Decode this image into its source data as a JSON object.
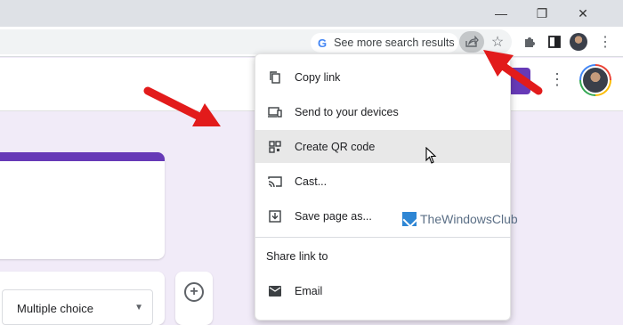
{
  "window": {
    "minimize_glyph": "—",
    "restore_glyph": "❐",
    "close_glyph": "✕"
  },
  "toolbar": {
    "search_chip": {
      "icon": "google-g-icon",
      "g_letter": "G",
      "label": "See more search results"
    },
    "share_icon": "share-icon",
    "star_glyph": "☆",
    "extensions_icon": "puzzle-icon",
    "side_panel_icon": "side-panel-icon",
    "more_glyph": "⋮"
  },
  "forms_header": {
    "more_glyph": "⋮"
  },
  "form": {
    "question_type": "Multiple choice",
    "dropdown_glyph": "▼",
    "add_question_glyph": "+"
  },
  "share_menu": {
    "items": [
      {
        "label": "Copy link",
        "icon": "copy-icon"
      },
      {
        "label": "Send to your devices",
        "icon": "devices-icon"
      },
      {
        "label": "Create QR code",
        "icon": "qr-code-icon"
      },
      {
        "label": "Cast...",
        "icon": "cast-icon"
      },
      {
        "label": "Save page as...",
        "icon": "save-page-icon"
      }
    ],
    "share_heading": "Share link to",
    "share_targets": [
      {
        "label": "Email",
        "icon": "email-icon"
      }
    ]
  },
  "watermark": {
    "text": "TheWindowsClub"
  },
  "colors": {
    "accent_purple": "#673ab7",
    "annotation_red": "#e21b1b",
    "menu_hover": "#e8e8e8",
    "page_background": "#f1ebf8"
  }
}
